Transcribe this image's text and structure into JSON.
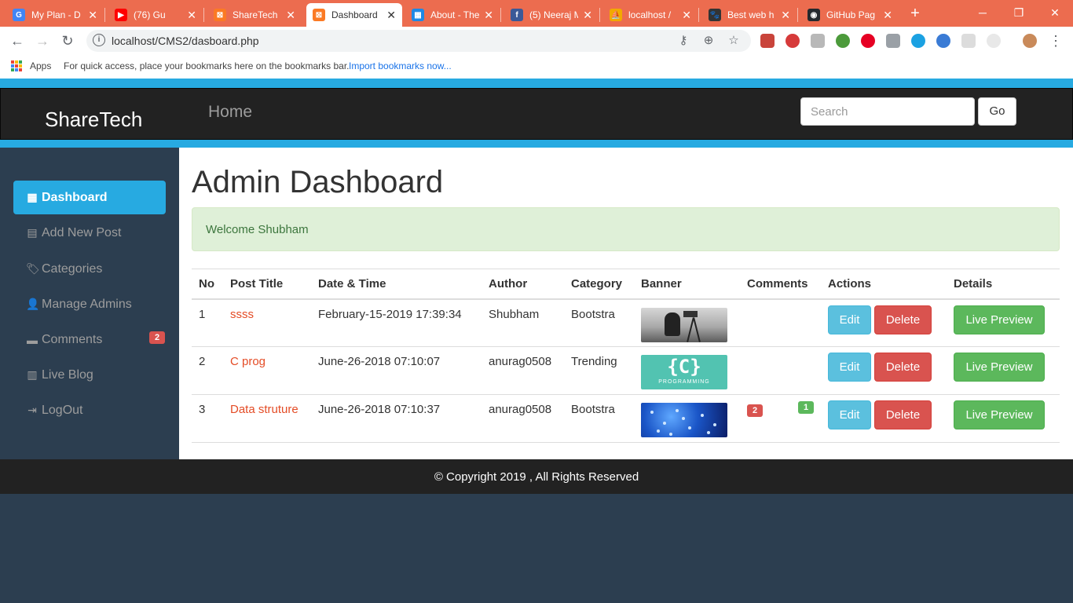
{
  "browser": {
    "tabs": [
      {
        "title": "My Plan - D",
        "favicon": "google-icon",
        "color": "#4285f4",
        "glyph": "G"
      },
      {
        "title": "(76) Gu",
        "favicon": "youtube-icon",
        "color": "#ff0000",
        "glyph": "▶"
      },
      {
        "title": "ShareTech",
        "favicon": "xampp-icon",
        "color": "#fb7a24",
        "glyph": "⊠"
      },
      {
        "title": "Dashboard",
        "favicon": "xampp-icon",
        "color": "#fb7a24",
        "glyph": "⊠"
      },
      {
        "title": "About - The",
        "favicon": "grid-icon",
        "color": "#1e88e5",
        "glyph": "▦"
      },
      {
        "title": "(5) Neeraj M",
        "favicon": "facebook-icon",
        "color": "#3b5998",
        "glyph": "f"
      },
      {
        "title": "localhost /",
        "favicon": "phpmyadmin-icon",
        "color": "#f2a900",
        "glyph": "⛵"
      },
      {
        "title": "Best web h",
        "favicon": "paw-icon",
        "color": "#333333",
        "glyph": "🐾"
      },
      {
        "title": "GitHub Pag",
        "favicon": "github-icon",
        "color": "#24292e",
        "glyph": "◉"
      }
    ],
    "url": "localhost/CMS2/dasboard.php",
    "bookmarks": {
      "apps": "Apps",
      "hint": "For quick access, place your bookmarks here on the bookmarks bar.",
      "import_link": "Import bookmarks now..."
    }
  },
  "navbar": {
    "brand": "ShareTech",
    "home": "Home",
    "search_placeholder": "Search",
    "go": "Go"
  },
  "sidebar": {
    "items": [
      {
        "label": "Dashboard",
        "icon": "dashboard-grid-icon",
        "glyph": "▦"
      },
      {
        "label": "Add New Post",
        "icon": "list-icon",
        "glyph": "▤"
      },
      {
        "label": "Categories",
        "icon": "tags-icon",
        "glyph": "🏷"
      },
      {
        "label": "Manage Admins",
        "icon": "user-icon",
        "glyph": "👤"
      },
      {
        "label": "Comments",
        "icon": "comment-icon",
        "glyph": "▬",
        "badge": "2"
      },
      {
        "label": "Live Blog",
        "icon": "blog-icon",
        "glyph": "▥"
      },
      {
        "label": "LogOut",
        "icon": "logout-icon",
        "glyph": "⇥"
      }
    ]
  },
  "main": {
    "title": "Admin Dashboard",
    "welcome": "Welcome Shubham",
    "table": {
      "headers": [
        "No",
        "Post Title",
        "Date & Time",
        "Author",
        "Category",
        "Banner",
        "Comments",
        "Actions",
        "Details"
      ],
      "rows": [
        {
          "no": "1",
          "title": "ssss",
          "datetime": "February-15-2019 17:39:34",
          "author": "Shubham",
          "category": "Bootstra",
          "banner": "photographer-banner",
          "comments_unapproved": "",
          "comments_approved": ""
        },
        {
          "no": "2",
          "title": "C prog",
          "datetime": "June-26-2018 07:10:07",
          "author": "anurag0508",
          "category": "Trending",
          "banner": "c-programming-banner",
          "comments_unapproved": "",
          "comments_approved": ""
        },
        {
          "no": "3",
          "title": "Data struture",
          "datetime": "June-26-2018 07:10:37",
          "author": "anurag0508",
          "category": "Bootstra",
          "banner": "network-banner",
          "comments_unapproved": "2",
          "comments_approved": "1"
        }
      ],
      "edit_label": "Edit",
      "delete_label": "Delete",
      "preview_label": "Live Preview",
      "c_banner": {
        "big": "{C}",
        "small": "PROGRAMMING"
      }
    }
  },
  "footer": {
    "text": "© Copyright 2019 , All Rights Reserved"
  },
  "colors": {
    "accent": "#27aae1",
    "navbar": "#222222",
    "sidebar": "#2c3e50",
    "link": "#e44c26",
    "success": "#5cb85c",
    "danger": "#d9534f",
    "info": "#5bc0de"
  }
}
